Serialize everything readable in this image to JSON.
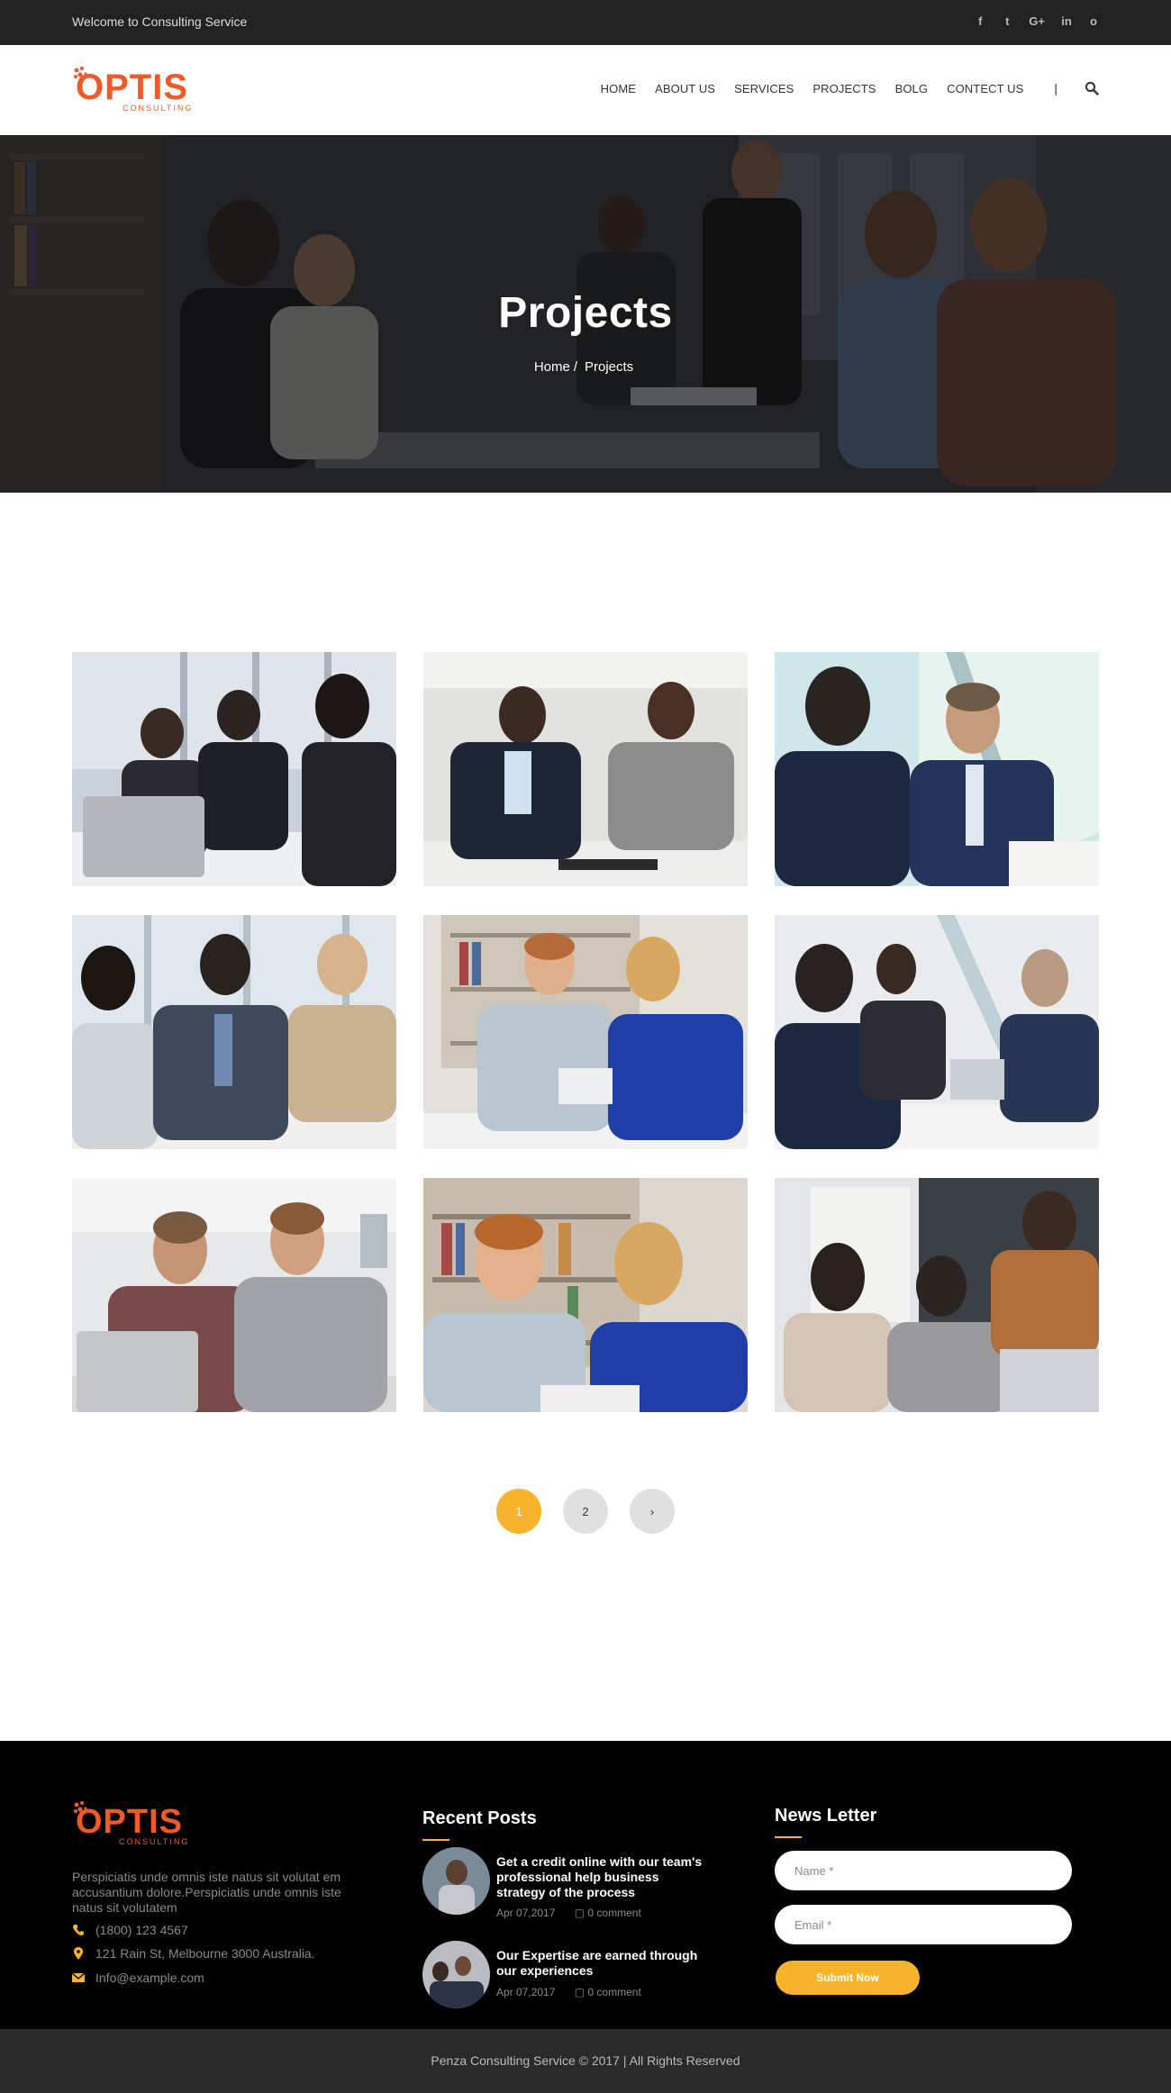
{
  "topbar": {
    "welcome": "Welcome to Consulting Service",
    "social": [
      "f",
      "t",
      "G+",
      "in",
      "o"
    ]
  },
  "brand": {
    "name": "OPTIS",
    "tagline": "CONSULTING",
    "accent": "#f05a28"
  },
  "nav": {
    "items": [
      "HOME",
      "ABOUT US",
      "SERVICES",
      "PROJECTS",
      "BOLG",
      "CONTECT US"
    ],
    "separator": "|"
  },
  "hero": {
    "title": "Projects",
    "breadcrumb_home": "Home",
    "breadcrumb_sep": "/",
    "breadcrumb_current": "Projects"
  },
  "pagination": {
    "pages": [
      "1",
      "2"
    ],
    "next": "›",
    "active_color": "#f7b32b"
  },
  "footer": {
    "about": "Perspiciatis unde omnis iste natus sit volutat em accusantium dolore.Perspiciatis unde omnis iste natus sit volutatem",
    "phone": "(1800) 123 4567",
    "address": "121 Rain St, Melbourne 3000 Australia.",
    "email": "Info@example.com",
    "recent_posts_title": "Recent Posts",
    "posts": [
      {
        "title": "Get a credit online with our team's professional help business strategy of the process",
        "date": "Apr 07,2017",
        "comments": "0 comment"
      },
      {
        "title": "Our Expertise are earned through our experiences",
        "date": "Apr 07,2017",
        "comments": "0 comment"
      }
    ],
    "newsletter_title": "News Letter",
    "name_placeholder": "Name *",
    "email_placeholder": "Email *",
    "submit_label": "Submit Now",
    "copyright": "Penza Consulting Service © 2017 | All Rights Reserved"
  }
}
